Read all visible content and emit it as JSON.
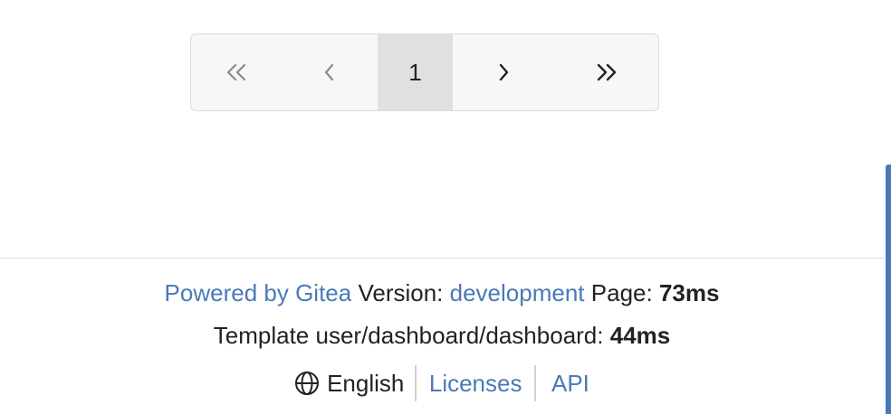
{
  "pagination": {
    "first_icon": "double-chevron-left-icon",
    "prev_icon": "chevron-left-icon",
    "current_page": "1",
    "next_icon": "chevron-right-icon",
    "last_icon": "double-chevron-right-icon"
  },
  "footer": {
    "powered_by": "Powered by Gitea",
    "version_label": "Version:",
    "version_value": "development",
    "page_label": "Page:",
    "page_time": "73ms",
    "template_label": "Template user/dashboard/dashboard:",
    "template_time": "44ms",
    "language_icon": "globe-icon",
    "language": "English",
    "licenses": "Licenses",
    "api": "API"
  },
  "colors": {
    "link": "#4b79b7",
    "active_page_bg": "#e0e0e0",
    "border": "#dcdcdc"
  }
}
